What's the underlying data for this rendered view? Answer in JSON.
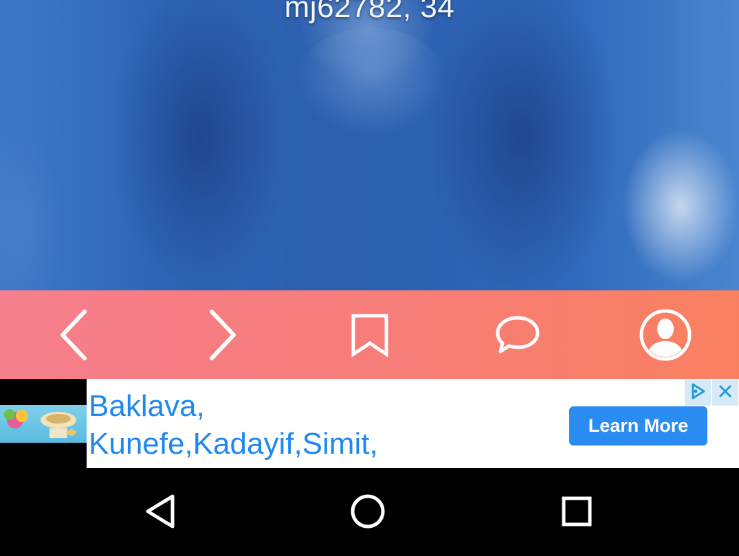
{
  "profile": {
    "caption": "mj62782, 34"
  },
  "toolbar": {
    "items": [
      {
        "name": "previous",
        "icon": "chevron-left-icon"
      },
      {
        "name": "next",
        "icon": "chevron-right-icon"
      },
      {
        "name": "bookmark",
        "icon": "bookmark-icon"
      },
      {
        "name": "message",
        "icon": "chat-bubble-icon"
      },
      {
        "name": "profile",
        "icon": "user-avatar-icon"
      }
    ],
    "colors": {
      "start": "#f57f8c",
      "end": "#f9805f",
      "icon": "#ffffff"
    }
  },
  "ad": {
    "title_line1": "Baklava,",
    "title_line2": "Kunefe,Kadayif,Simit,",
    "cta_label": "Learn More",
    "choices_icon": "ad-choices-icon",
    "close_icon": "close-icon",
    "colors": {
      "title": "#1e88f0",
      "cta": "#2a8cf1"
    }
  },
  "navbar": {
    "back_icon": "back-triangle-icon",
    "home_icon": "home-circle-icon",
    "recents_icon": "recents-square-icon"
  }
}
